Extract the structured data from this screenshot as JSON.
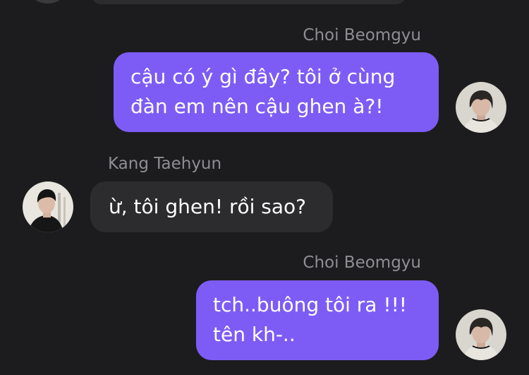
{
  "messages": [
    {
      "sender": "Choi Beomgyu",
      "direction": "outgoing",
      "lines": [
        "cậu có ý gì đây? tôi ở cùng",
        "đàn em nên cậu ghen à?!"
      ]
    },
    {
      "sender": "Kang Taehyun",
      "direction": "incoming",
      "lines": [
        "ừ, tôi ghen! rồi sao?"
      ]
    },
    {
      "sender": "Choi Beomgyu",
      "direction": "outgoing",
      "lines": [
        "tch..buông tôi ra !!!",
        "tên kh-.."
      ]
    }
  ],
  "colors": {
    "background": "#1c1c1e",
    "outgoing_bubble": "#7d5cf6",
    "incoming_bubble": "#2c2c2e",
    "sender_name": "#8e8e93",
    "message_text": "#ffffff"
  }
}
